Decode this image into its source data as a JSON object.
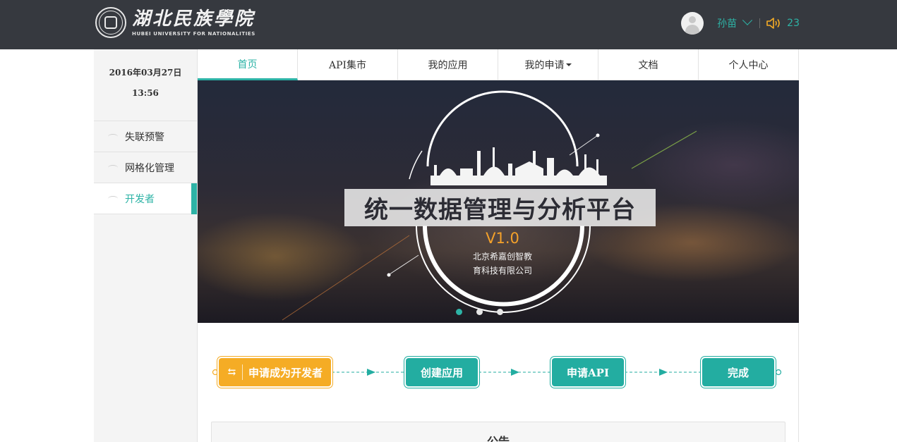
{
  "header": {
    "logo_cn": "湖北民族學院",
    "logo_en": "HUBEI UNIVERSITY FOR NATIONALITIES",
    "user_name": "孙苗",
    "notification_count": "23",
    "background_color": "#36393f",
    "accent_color": "#2db3a6"
  },
  "sidebar": {
    "date": "2016年03月27日",
    "time": "13:56",
    "items": [
      {
        "label": "失联预警",
        "icon": "menu-icon",
        "active": false
      },
      {
        "label": "网格化管理",
        "icon": "menu-icon",
        "active": false
      },
      {
        "label": "开发者",
        "icon": "menu-icon",
        "active": true
      }
    ]
  },
  "tabs": [
    {
      "label": "首页",
      "active": true
    },
    {
      "label": "API集市",
      "active": false
    },
    {
      "label": "我的应用",
      "active": false
    },
    {
      "label": "我的申请",
      "active": false,
      "dropdown": true
    },
    {
      "label": "文档",
      "active": false
    },
    {
      "label": "个人中心",
      "active": false
    }
  ],
  "banner": {
    "title": "统一数据管理与分析平台",
    "version": "V1.0",
    "company_line1": "北京希嘉创智教",
    "company_line2": "育科技有限公司",
    "slides_total": 3,
    "active_slide": 1
  },
  "steps": [
    {
      "label": "申请成为开发者",
      "color": "#f5ac25",
      "icon": "swap-icon"
    },
    {
      "label": "创建应用",
      "color": "#23ada1"
    },
    {
      "label": "申请API",
      "color": "#23ada1"
    },
    {
      "label": "完成",
      "color": "#23ada1"
    }
  ],
  "notice": {
    "title": "公告"
  }
}
